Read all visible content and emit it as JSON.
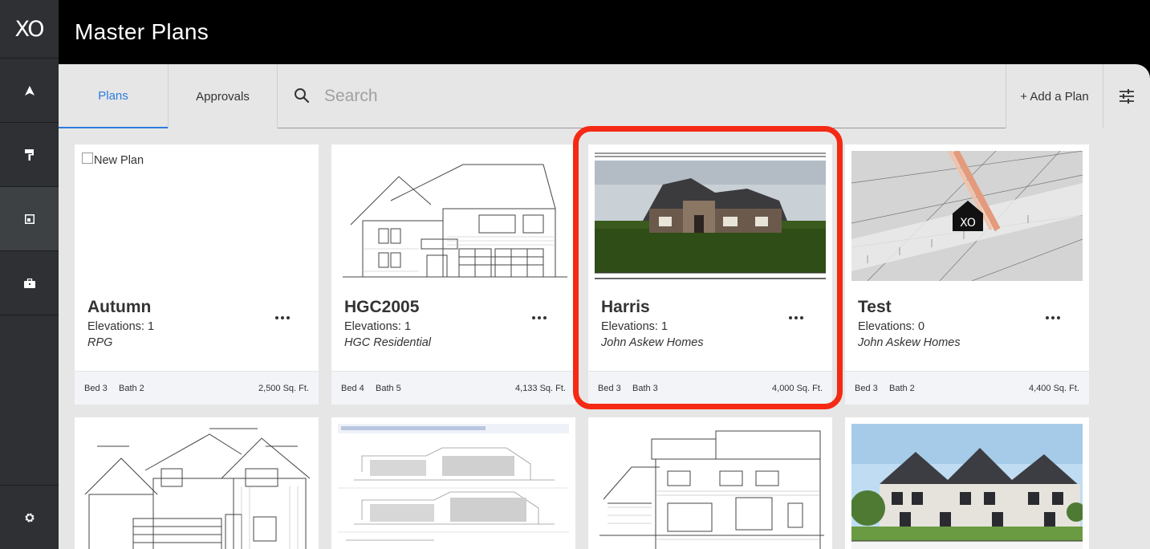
{
  "app": {
    "logo": "XO",
    "title": "Master Plans"
  },
  "tabs": [
    {
      "label": "Plans",
      "active": true
    },
    {
      "label": "Approvals",
      "active": false
    }
  ],
  "search": {
    "placeholder": "Search",
    "value": ""
  },
  "toolbar": {
    "add_plan_label": "+ Add a Plan"
  },
  "new_plan_label": "New Plan",
  "plans": [
    {
      "name": "Autumn",
      "elevations": "Elevations: 1",
      "builder": "RPG",
      "bed": "Bed 3",
      "bath": "Bath 2",
      "sqft": "2,500 Sq. Ft."
    },
    {
      "name": "HGC2005",
      "elevations": "Elevations: 1",
      "builder": "HGC Residential",
      "bed": "Bed 4",
      "bath": "Bath 5",
      "sqft": "4,133 Sq. Ft."
    },
    {
      "name": "Harris",
      "elevations": "Elevations: 1",
      "builder": "John Askew Homes",
      "bed": "Bed 3",
      "bath": "Bath 3",
      "sqft": "4,000 Sq. Ft."
    },
    {
      "name": "Test",
      "elevations": "Elevations: 0",
      "builder": "John Askew Homes",
      "bed": "Bed 3",
      "bath": "Bath 2",
      "sqft": "4,400 Sq. Ft."
    }
  ],
  "colors": {
    "accent": "#2b7de0",
    "highlight": "#f42a14",
    "sidebar": "#2e3033"
  }
}
